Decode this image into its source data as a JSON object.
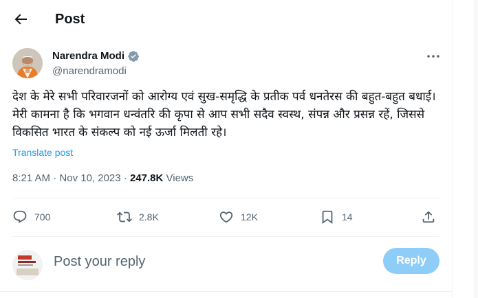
{
  "header": {
    "title": "Post",
    "back_icon": "arrow-left-icon"
  },
  "author": {
    "name": "Narendra Modi",
    "handle": "@narendramodi",
    "verified_color": "#829aab",
    "verified_icon": "verified-badge-icon"
  },
  "post": {
    "text": "देश के मेरे सभी परिवारजनों को आरोग्य एवं सुख-समृद्धि के प्रतीक पर्व धनतेरस की बहुत-बहुत बधाई। मेरी कामना है कि भगवान धन्वंतरि की कृपा से आप सभी सदैव स्वस्थ, संपन्न और प्रसन्न रहें, जिससे विकसित भारत के संकल्प को नई ऊर्जा मिलती रहे।",
    "translate_label": "Translate post",
    "time": "8:21 AM",
    "date": "Nov 10, 2023",
    "views_count": "247.8K",
    "views_label": "Views",
    "separator": "·"
  },
  "actions": {
    "replies": "700",
    "reposts": "2.8K",
    "likes": "12K",
    "bookmarks": "14"
  },
  "reply": {
    "placeholder": "Post your reply",
    "button_label": "Reply",
    "button_color": "#8ecdf7"
  },
  "colors": {
    "accent": "#1d9bf0",
    "muted": "#536471",
    "text": "#0f1419"
  }
}
